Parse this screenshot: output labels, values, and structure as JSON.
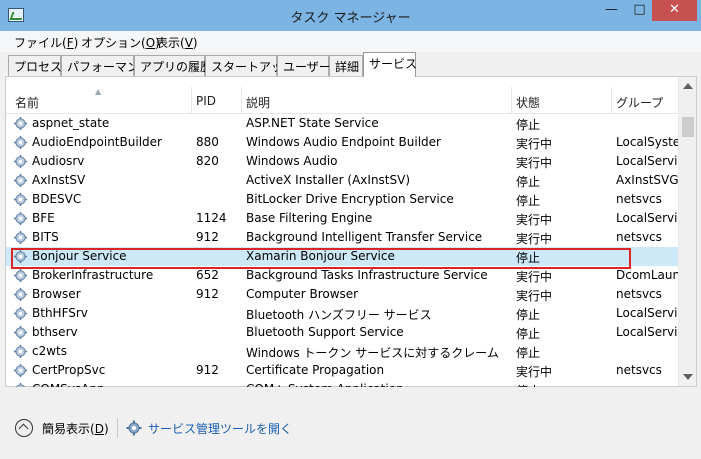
{
  "window": {
    "title": "タスク マネージャー",
    "controls": {
      "minimize": "—",
      "maximize": "□",
      "close": "✕"
    }
  },
  "menu": [
    {
      "label": "ファイル(",
      "key": "F",
      "end": ")"
    },
    {
      "label": "オプション(",
      "key": "O",
      "end": ")"
    },
    {
      "label": "表示(",
      "key": "V",
      "end": ")"
    }
  ],
  "tabs": [
    "プロセス",
    "パフォーマンス",
    "アプリの履歴",
    "スタートアップ",
    "ユーザー",
    "詳細",
    "サービス"
  ],
  "active_tab": "サービス",
  "columns": {
    "name": "名前",
    "pid": "PID",
    "description": "説明",
    "status": "状態",
    "group": "グループ"
  },
  "rows": [
    {
      "name": "aspnet_state",
      "pid": "",
      "description": "ASP.NET State Service",
      "status": "停止",
      "group": ""
    },
    {
      "name": "AudioEndpointBuilder",
      "pid": "880",
      "description": "Windows Audio Endpoint Builder",
      "status": "実行中",
      "group": "LocalSyste"
    },
    {
      "name": "Audiosrv",
      "pid": "820",
      "description": "Windows Audio",
      "status": "実行中",
      "group": "LocalServi"
    },
    {
      "name": "AxInstSV",
      "pid": "",
      "description": "ActiveX Installer (AxInstSV)",
      "status": "停止",
      "group": "AxInstSVG"
    },
    {
      "name": "BDESVC",
      "pid": "",
      "description": "BitLocker Drive Encryption Service",
      "status": "停止",
      "group": "netsvcs"
    },
    {
      "name": "BFE",
      "pid": "1124",
      "description": "Base Filtering Engine",
      "status": "実行中",
      "group": "LocalServi"
    },
    {
      "name": "BITS",
      "pid": "912",
      "description": "Background Intelligent Transfer Service",
      "status": "実行中",
      "group": "netsvcs"
    },
    {
      "name": "Bonjour Service",
      "pid": "",
      "description": "Xamarin Bonjour Service",
      "status": "停止",
      "group": ""
    },
    {
      "name": "BrokerInfrastructure",
      "pid": "652",
      "description": "Background Tasks Infrastructure Service",
      "status": "実行中",
      "group": "DcomLaun"
    },
    {
      "name": "Browser",
      "pid": "912",
      "description": "Computer Browser",
      "status": "実行中",
      "group": "netsvcs"
    },
    {
      "name": "BthHFSrv",
      "pid": "",
      "description": "Bluetooth ハンズフリー サービス",
      "status": "停止",
      "group": "LocalServi"
    },
    {
      "name": "bthserv",
      "pid": "",
      "description": "Bluetooth Support Service",
      "status": "停止",
      "group": "LocalServi"
    },
    {
      "name": "c2wts",
      "pid": "",
      "description": "Windows トークン サービスに対するクレーム",
      "status": "停止",
      "group": ""
    },
    {
      "name": "CertPropSvc",
      "pid": "912",
      "description": "Certificate Propagation",
      "status": "実行中",
      "group": "netsvcs"
    },
    {
      "name": "COMSysApp",
      "pid": "",
      "description": "COM+ System Application",
      "status": "停止",
      "group": ""
    }
  ],
  "selected_row": "Bonjour Service",
  "footer": {
    "fewer_details_label": "簡易表示(",
    "fewer_details_key": "D",
    "fewer_details_end": ")",
    "open_services_label": "サービス管理ツールを開く"
  },
  "colors": {
    "titlebar": "#7cb5e3",
    "close_button": "#c75050",
    "selection": "#cde8f7",
    "highlight_border": "#d92525",
    "link": "#1a5fb4"
  },
  "icons": {
    "app": "task-manager-icon",
    "service": "gear-icon",
    "collapse": "chevron-up-icon"
  }
}
